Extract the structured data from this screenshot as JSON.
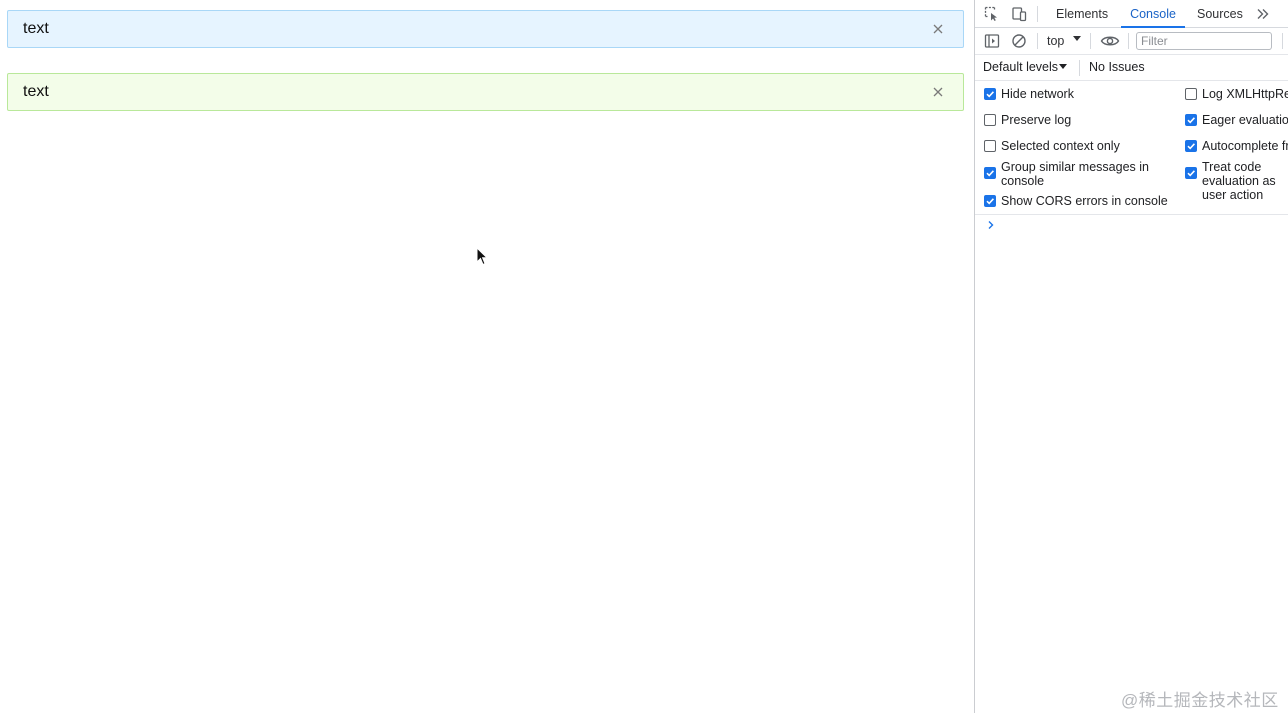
{
  "app": {
    "alerts": [
      {
        "type": "info",
        "text": "text",
        "close_icon": "close-icon",
        "color": "#e6f4ff"
      },
      {
        "type": "success",
        "text": "text",
        "close_icon": "close-icon",
        "color": "#f3fde9"
      }
    ]
  },
  "devtools": {
    "icons": {
      "inspect": "inspect-element-icon",
      "device": "device-toolbar-icon",
      "more_tabs": "more-tabs-icon",
      "sidebar": "console-sidebar-icon",
      "clear": "clear-console-icon",
      "eye": "live-expression-icon",
      "prompt": "console-prompt-icon"
    },
    "tabs": [
      {
        "label": "Elements",
        "active": false
      },
      {
        "label": "Console",
        "active": true
      },
      {
        "label": "Sources",
        "active": false
      }
    ],
    "toolbar": {
      "context": "top",
      "filter_placeholder": "Filter",
      "filter_value": ""
    },
    "levels_label": "Default levels",
    "issues_label": "No Issues",
    "settings": {
      "left": [
        {
          "label": "Hide network",
          "checked": true
        },
        {
          "label": "Preserve log",
          "checked": false
        },
        {
          "label": "Selected context only",
          "checked": false
        },
        {
          "label": "Group similar messages in console",
          "checked": true
        },
        {
          "label": "Show CORS errors in console",
          "checked": true
        }
      ],
      "right": [
        {
          "label": "Log XMLHttpRequests",
          "checked": false
        },
        {
          "label": "Eager evaluation",
          "checked": true
        },
        {
          "label": "Autocomplete from history",
          "checked": true
        },
        {
          "label": "Treat code evaluation as user action",
          "checked": true
        }
      ]
    },
    "accent_color": "#1a73e8"
  },
  "watermark": "@稀土掘金技术社区"
}
